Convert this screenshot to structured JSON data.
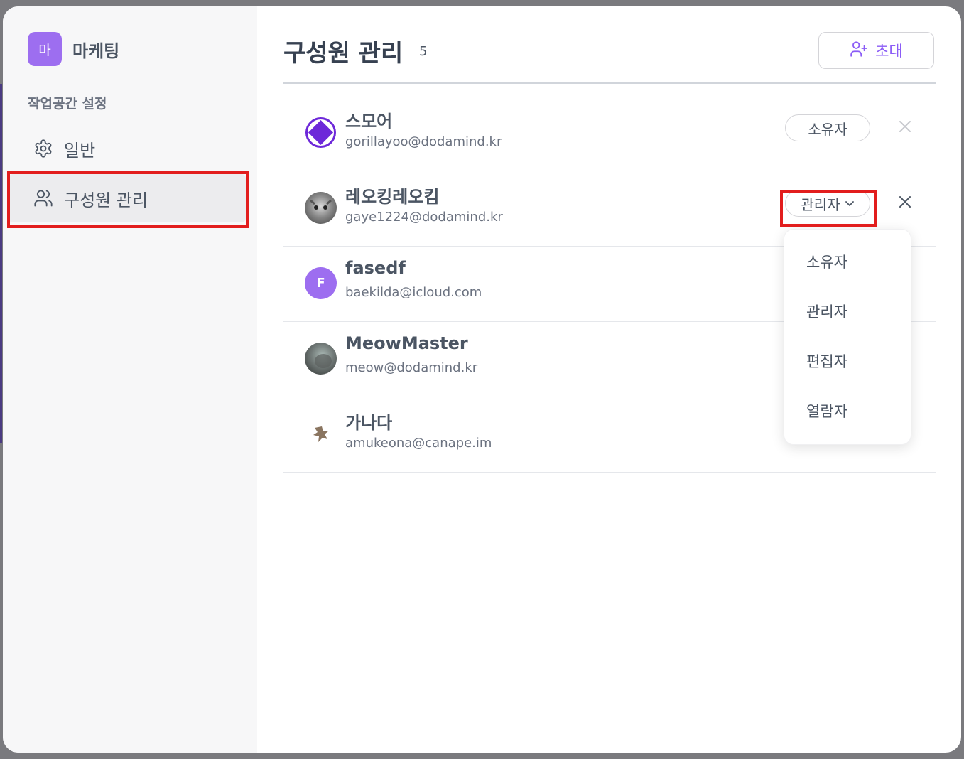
{
  "sidebar": {
    "workspace_initial": "마",
    "workspace_name": "마케팅",
    "section_label": "작업공간 설정",
    "nav": [
      {
        "label": "일반",
        "icon": "gear-icon"
      },
      {
        "label": "구성원 관리",
        "icon": "users-icon"
      }
    ]
  },
  "header": {
    "title": "구성원 관리",
    "count": "5",
    "invite_label": "초대",
    "invite_icon": "user-plus-icon"
  },
  "members": [
    {
      "name": "스모어",
      "email": "gorillayoo@dodamind.kr",
      "role": "소유자",
      "role_editable": false
    },
    {
      "name": "레오킹레오킴",
      "email": "gaye1224@dodamind.kr",
      "role": "관리자",
      "role_editable": true
    },
    {
      "name": "fasedf",
      "email": "baekilda@icloud.com",
      "avatar_initial": "F"
    },
    {
      "name": "MeowMaster",
      "email": "meow@dodamind.kr"
    },
    {
      "name": "가나다",
      "email": "amukeona@canape.im"
    }
  ],
  "role_dropdown": {
    "options": [
      "소유자",
      "관리자",
      "편집자",
      "열람자"
    ]
  },
  "colors": {
    "accent": "#9d6ef0",
    "highlight": "#e21d1d",
    "diamond": "#6d28d9"
  }
}
